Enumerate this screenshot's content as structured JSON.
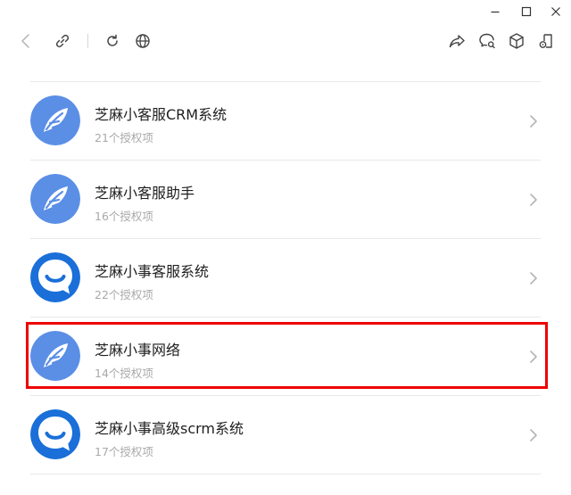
{
  "window": {
    "minimize_icon": "minimize-icon",
    "maximize_icon": "maximize-icon",
    "close_icon": "close-icon"
  },
  "toolbar": {
    "left_icons": [
      "back-arrow-icon",
      "link-icon",
      "refresh-icon",
      "globe-icon"
    ],
    "right_icons": [
      "share-icon",
      "chat-search-icon",
      "cube-icon",
      "mini-program-icon"
    ]
  },
  "apps": [
    {
      "name": "芝麻小客服CRM系统",
      "permissions": "21个授权项",
      "icon": "leaf-logo-icon"
    },
    {
      "name": "芝麻小客服助手",
      "permissions": "16个授权项",
      "icon": "leaf-logo-icon"
    },
    {
      "name": "芝麻小事客服系统",
      "permissions": "22个授权项",
      "icon": "chat-bubble-logo-icon"
    },
    {
      "name": "芝麻小事网络",
      "permissions": "14个授权项",
      "icon": "leaf-logo-icon"
    },
    {
      "name": "芝麻小事高级scrm系统",
      "permissions": "17个授权项",
      "icon": "chat-bubble-logo-icon"
    }
  ],
  "highlighted_index": 3,
  "colors": {
    "leaf_logo_bg": "#5b8fe6",
    "chat_logo_bg": "#1a6fd9",
    "highlight_border": "#ee0000"
  }
}
